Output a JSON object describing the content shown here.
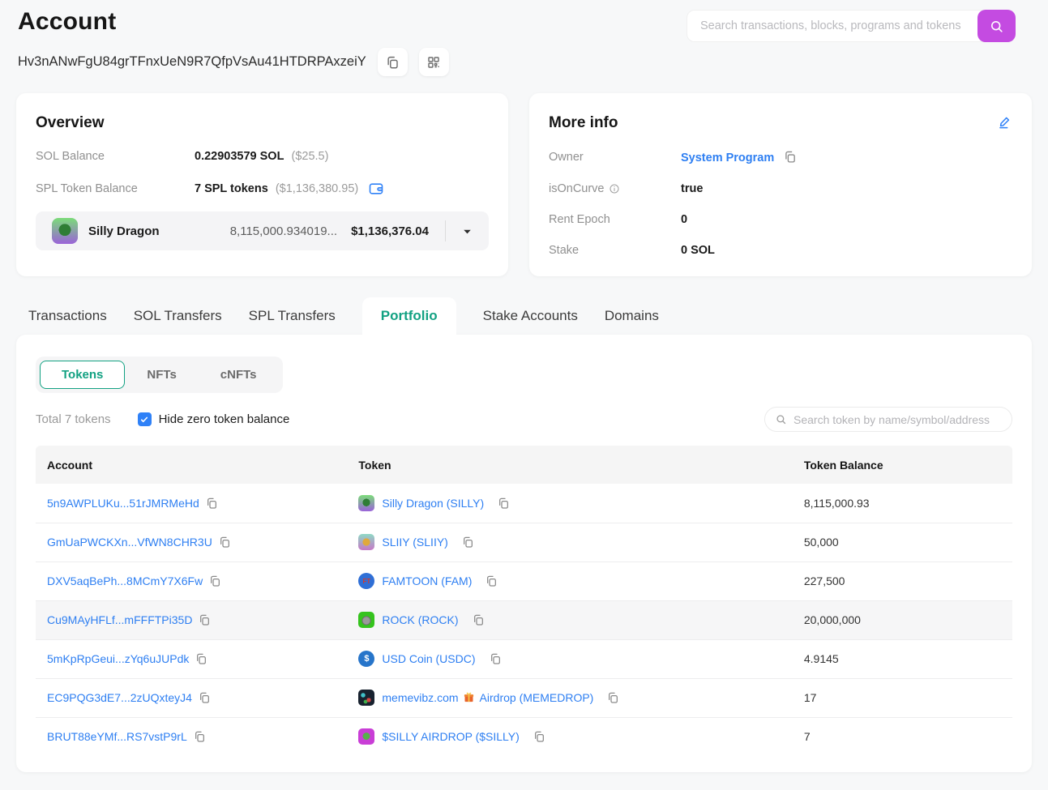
{
  "page": {
    "title": "Account",
    "address": "Hv3nANwFgU84grTFnxUeN9R7QfpVsAu41HTDRPAxzeiY"
  },
  "header_search": {
    "placeholder": "Search transactions, blocks, programs and tokens"
  },
  "overview": {
    "title": "Overview",
    "sol_balance_label": "SOL Balance",
    "sol_balance_value": "0.22903579 SOL",
    "sol_balance_usd": "($25.5)",
    "spl_balance_label": "SPL Token Balance",
    "spl_balance_value": "7 SPL tokens",
    "spl_balance_usd": "($1,136,380.95)",
    "token_selector": {
      "name": "Silly Dragon",
      "amount": "8,115,000.934019...",
      "usd": "$1,136,376.04"
    }
  },
  "more_info": {
    "title": "More info",
    "owner_label": "Owner",
    "owner_value": "System Program",
    "is_on_curve_label": "isOnCurve",
    "is_on_curve_value": "true",
    "rent_epoch_label": "Rent Epoch",
    "rent_epoch_value": "0",
    "stake_label": "Stake",
    "stake_value": "0 SOL"
  },
  "tabs": {
    "active": "Portfolio",
    "items": [
      {
        "label": "Transactions"
      },
      {
        "label": "SOL Transfers"
      },
      {
        "label": "SPL Transfers"
      },
      {
        "label": "Portfolio"
      },
      {
        "label": "Stake Accounts"
      },
      {
        "label": "Domains"
      }
    ]
  },
  "portfolio": {
    "subtabs": [
      {
        "label": "Tokens"
      },
      {
        "label": "NFTs"
      },
      {
        "label": "cNFTs"
      }
    ],
    "active_subtab": "Tokens",
    "total_text": "Total 7 tokens",
    "hide_zero_label": "Hide zero token balance",
    "hide_zero_checked": "true",
    "search_placeholder": "Search token by name/symbol/address",
    "table": {
      "headers": {
        "account": "Account",
        "token": "Token",
        "balance": "Token Balance"
      },
      "rows": [
        {
          "account": "5n9AWPLUKu...51rJMRMeHd",
          "token": "Silly Dragon (SILLY)",
          "balance": "8,115,000.93",
          "icon": "silly-dragon-token-icon"
        },
        {
          "account": "GmUaPWCKXn...VfWN8CHR3U",
          "token": "SLIIY (SLIIY)",
          "balance": "50,000",
          "icon": "sliiy-token-icon"
        },
        {
          "account": "DXV5aqBePh...8MCmY7X6Fw",
          "token": "FAMTOON (FAM)",
          "balance": "227,500",
          "icon": "famtoon-token-icon"
        },
        {
          "account": "Cu9MAyHFLf...mFFFTPi35D",
          "token": "ROCK (ROCK)",
          "balance": "20,000,000",
          "icon": "rock-token-icon"
        },
        {
          "account": "5mKpRpGeui...zYq6uJUPdk",
          "token": "USD Coin (USDC)",
          "balance": "4.9145",
          "icon": "usdc-token-icon"
        },
        {
          "account": "EC9PQG3dE7...2zUQxteyJ4",
          "token_prefix": "memevibz.com",
          "token_suffix": "Airdrop (MEMEDROP)",
          "balance": "17",
          "icon": "memedrop-token-icon"
        },
        {
          "account": "BRUT88eYMf...RS7vstP9rL",
          "token": "$SILLY AIRDROP ($SILLY)",
          "balance": "7",
          "icon": "silly-airdrop-token-icon"
        }
      ]
    }
  },
  "colors": {
    "accent_purple": "#c44be1",
    "link_blue": "#2e7ff2",
    "active_green": "#12a182",
    "checkbox_blue": "#2f81f7"
  }
}
